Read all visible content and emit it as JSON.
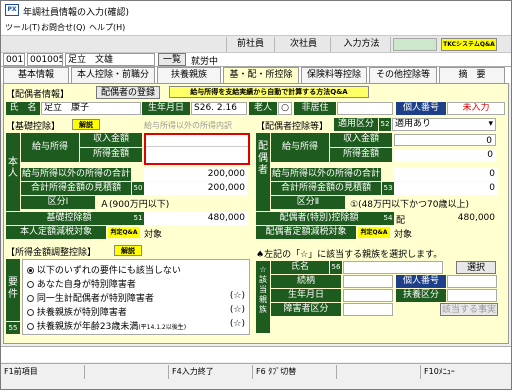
{
  "window": {
    "title": "年調社員情報の入力(確認)",
    "app_icon": "PX"
  },
  "menu": [
    {
      "label": "ツール(T)"
    },
    {
      "label": "お問合せ(Q)"
    },
    {
      "label": "ヘルプ(H)"
    }
  ],
  "toolbar": {
    "prev": "前社員",
    "next": "次社員",
    "input_method": "入力方法",
    "tkc": "TKCシステムQ&A"
  },
  "employee": {
    "code1": "001",
    "code2": "001005",
    "name": "足立　文雄",
    "list_btn": "一覧",
    "status": "就労中"
  },
  "tabs": [
    {
      "label": "基本情報",
      "active": false
    },
    {
      "label": "本人控除・前職分",
      "active": false
    },
    {
      "label": "扶養親族",
      "active": false
    },
    {
      "label": "基・配・所控除",
      "active": true
    },
    {
      "label": "保険料等控除",
      "active": false
    },
    {
      "label": "その他控除等",
      "active": false
    },
    {
      "label": "摘　要",
      "active": false
    }
  ],
  "spouse_info": {
    "title": "【配偶者情報】",
    "register_btn": "配偶者の登録",
    "calc_btn": "給与所得を支給実績から自動で計算する方法Q&A",
    "name_label": "氏　名",
    "name": "足立　康子",
    "birth_label": "生年月日",
    "birth": "S26. 2.16",
    "elder_label": "老人",
    "elder_mark": "○",
    "nonresident_label": "非居住",
    "mynumber_label": "個人番号",
    "mynumber_value": "未入力"
  },
  "basic": {
    "title": "【基礎控除】",
    "explain_btn": "解説",
    "vertical_label": "本人",
    "other_income_hint": "給与所得以外の所得内訳",
    "salary_label": "給与所得",
    "income_label": "収入金額",
    "income_value": "",
    "shotoku_label": "所得金額",
    "shotoku_value": "",
    "other_total_label": "給与所得以外の所得の合計",
    "other_total_value": "200,000",
    "total_est_label": "合計所得金額の見積額",
    "total_est_num": "50",
    "total_est_value": "200,000",
    "kubun_label": "区分Ⅰ",
    "kubun_value": "Ａ(900万円以下)",
    "deduction_label": "基礎控除額",
    "deduction_num": "51",
    "deduction_value": "480,000",
    "teigaku_label": "本人定額減税対象",
    "teigaku_btn": "判定Q&A",
    "teigaku_value": "対象"
  },
  "spouse_ded": {
    "title": "【配偶者控除等】",
    "applicable_label": "適用区分",
    "applicable_num": "52",
    "applicable_value": "適用あり",
    "vertical_label": "配偶者",
    "income_label": "収入金額",
    "income_value": "0",
    "shotoku_label": "所得金額",
    "shotoku_value": "0",
    "salary_label": "給与所得",
    "other_total_label": "給与所得以外の所得の合計",
    "other_total_value": "0",
    "total_est_label": "合計所得金額の見積額",
    "total_est_num": "53",
    "total_est_value": "0",
    "kubun_label": "区分Ⅱ",
    "kubun_value": "①(48万円以下かつ70歳以上)",
    "deduction_label": "配偶者(特別)控除額",
    "deduction_num": "54",
    "deduction_prefix": "配",
    "deduction_value": "480,000",
    "teigaku_label": "配偶者定額減税対象",
    "teigaku_btn": "判定Q&A",
    "teigaku_value": "対象"
  },
  "adjust": {
    "title": "【所得金額調整控除】",
    "explain_btn": "解説",
    "vertical_label": "要件",
    "num": "55",
    "options": [
      {
        "label": "以下のいずれの要件にも該当しない",
        "selected": true,
        "mark": ""
      },
      {
        "label": "あなた自身が特別障害者",
        "selected": false,
        "mark": ""
      },
      {
        "label": "同一生計配偶者が特別障害者",
        "selected": false,
        "mark": "(☆)"
      },
      {
        "label": "扶養親族が特別障害者",
        "selected": false,
        "mark": "(☆)"
      },
      {
        "label": "扶養親族が年齢23歳未満",
        "note": "(平14.1.2以後生)",
        "selected": false,
        "mark": "(☆)"
      }
    ]
  },
  "relative": {
    "instruction": "左記の「☆」に該当する親族を選択します。",
    "vertical_label": "☆該当親族",
    "select_btn": "選択",
    "name_label": "氏名",
    "name_num": "56",
    "relation_label": "続柄",
    "mynumber_label": "個人番号",
    "birth_label": "生年月日",
    "dependent_label": "扶養区分",
    "disability_label": "障害者区分",
    "confirm_btn": "該当する事実"
  },
  "fkeys": [
    {
      "label": "F1前項目"
    },
    {
      "label": ""
    },
    {
      "label": "F4入力終了"
    },
    {
      "label": "F6 ﾀﾌﾞ切替"
    },
    {
      "label": ""
    },
    {
      "label": "F10ﾒﾆｭｰ"
    }
  ],
  "colors": {
    "panel_bg": "#ffffd0",
    "label_green": "#1e5b1e",
    "highlight_red": "#e00000",
    "accent_yellow": "#ffff00"
  }
}
